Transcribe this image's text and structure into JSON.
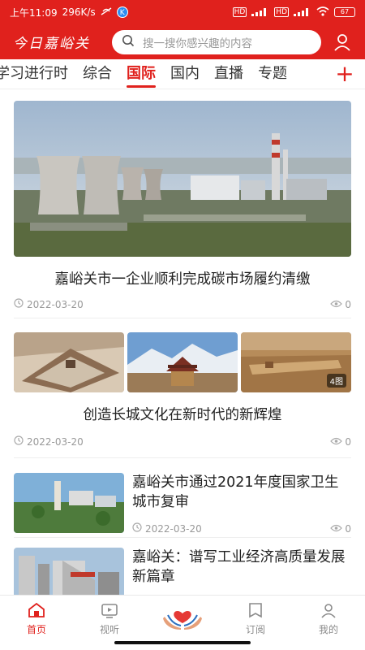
{
  "status_bar": {
    "time": "上午11:09",
    "speed": "296K/s",
    "k_badge": "K",
    "battery": "67"
  },
  "header": {
    "logo": "今日嘉峪关",
    "search_placeholder": "搜一搜你感兴趣的内容",
    "icons": {
      "search": "search-icon",
      "user": "user-icon"
    },
    "bg_color": "#e0211d"
  },
  "tabs": {
    "items": [
      {
        "label": "学习进行时"
      },
      {
        "label": "综合"
      },
      {
        "label": "国际",
        "active": true
      },
      {
        "label": "国内"
      },
      {
        "label": "直播"
      },
      {
        "label": "专题"
      }
    ],
    "add_label": "+",
    "accent_color": "#e0211d"
  },
  "feed": {
    "articles": [
      {
        "title": "嘉峪关市一企业顺利完成碳市场履约清缴",
        "date": "2022-03-20",
        "views": "0"
      },
      {
        "title": "创造长城文化在新时代的新辉煌",
        "date": "2022-03-20",
        "views": "0",
        "image_count": "4图"
      },
      {
        "title": "嘉峪关市通过2021年度国家卫生城市复审",
        "date": "2022-03-20",
        "views": "0"
      },
      {
        "title": "嘉峪关：谱写工业经济高质量发展新篇章"
      }
    ]
  },
  "bottom_nav": {
    "items": [
      {
        "label": "首页",
        "icon": "home-icon",
        "active": true
      },
      {
        "label": "视听",
        "icon": "tv-icon"
      },
      {
        "label": "",
        "icon": "heart-hands-icon"
      },
      {
        "label": "订阅",
        "icon": "subscribe-icon"
      },
      {
        "label": "我的",
        "icon": "profile-icon"
      }
    ]
  }
}
